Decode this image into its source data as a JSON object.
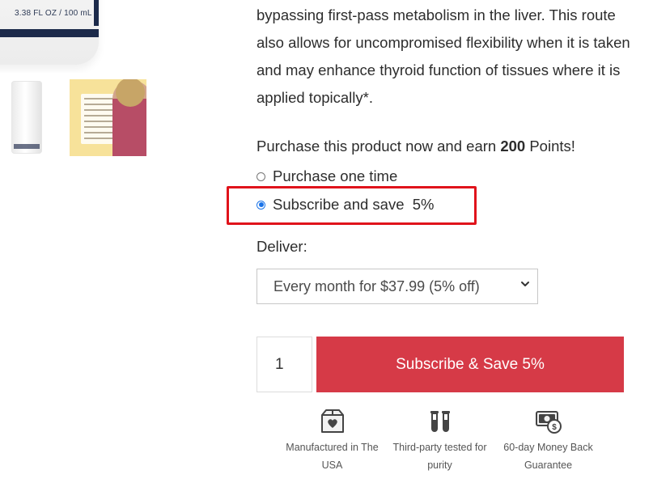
{
  "product_images": {
    "bottle_label": "3.38 FL OZ / 100 mL"
  },
  "description": "bypassing first-pass metabolism in the liver. This route also allows for uncompromised flexibility when it is taken and may enhance thyroid function of tissues where it is applied topically*.",
  "points": {
    "prefix": "Purchase this product now and earn ",
    "amount": "200",
    "suffix": " Points!"
  },
  "purchase_options": [
    {
      "label": "Purchase one time",
      "selected": false
    },
    {
      "label": "Subscribe and save  5%",
      "selected": true
    }
  ],
  "deliver": {
    "label": "Deliver:",
    "selected_option": "Every month for $37.99 (5% off)"
  },
  "quantity": "1",
  "cta_label": "Subscribe & Save 5%",
  "badges": [
    {
      "icon": "box-heart-icon",
      "label": "Manufactured in The USA"
    },
    {
      "icon": "test-tubes-icon",
      "label": "Third-party tested for purity"
    },
    {
      "icon": "money-back-icon",
      "label": "60-day Money Back Guarantee"
    }
  ],
  "colors": {
    "cta": "#d63a47",
    "highlight": "#e0131b",
    "radio_selected": "#1a73e8"
  }
}
